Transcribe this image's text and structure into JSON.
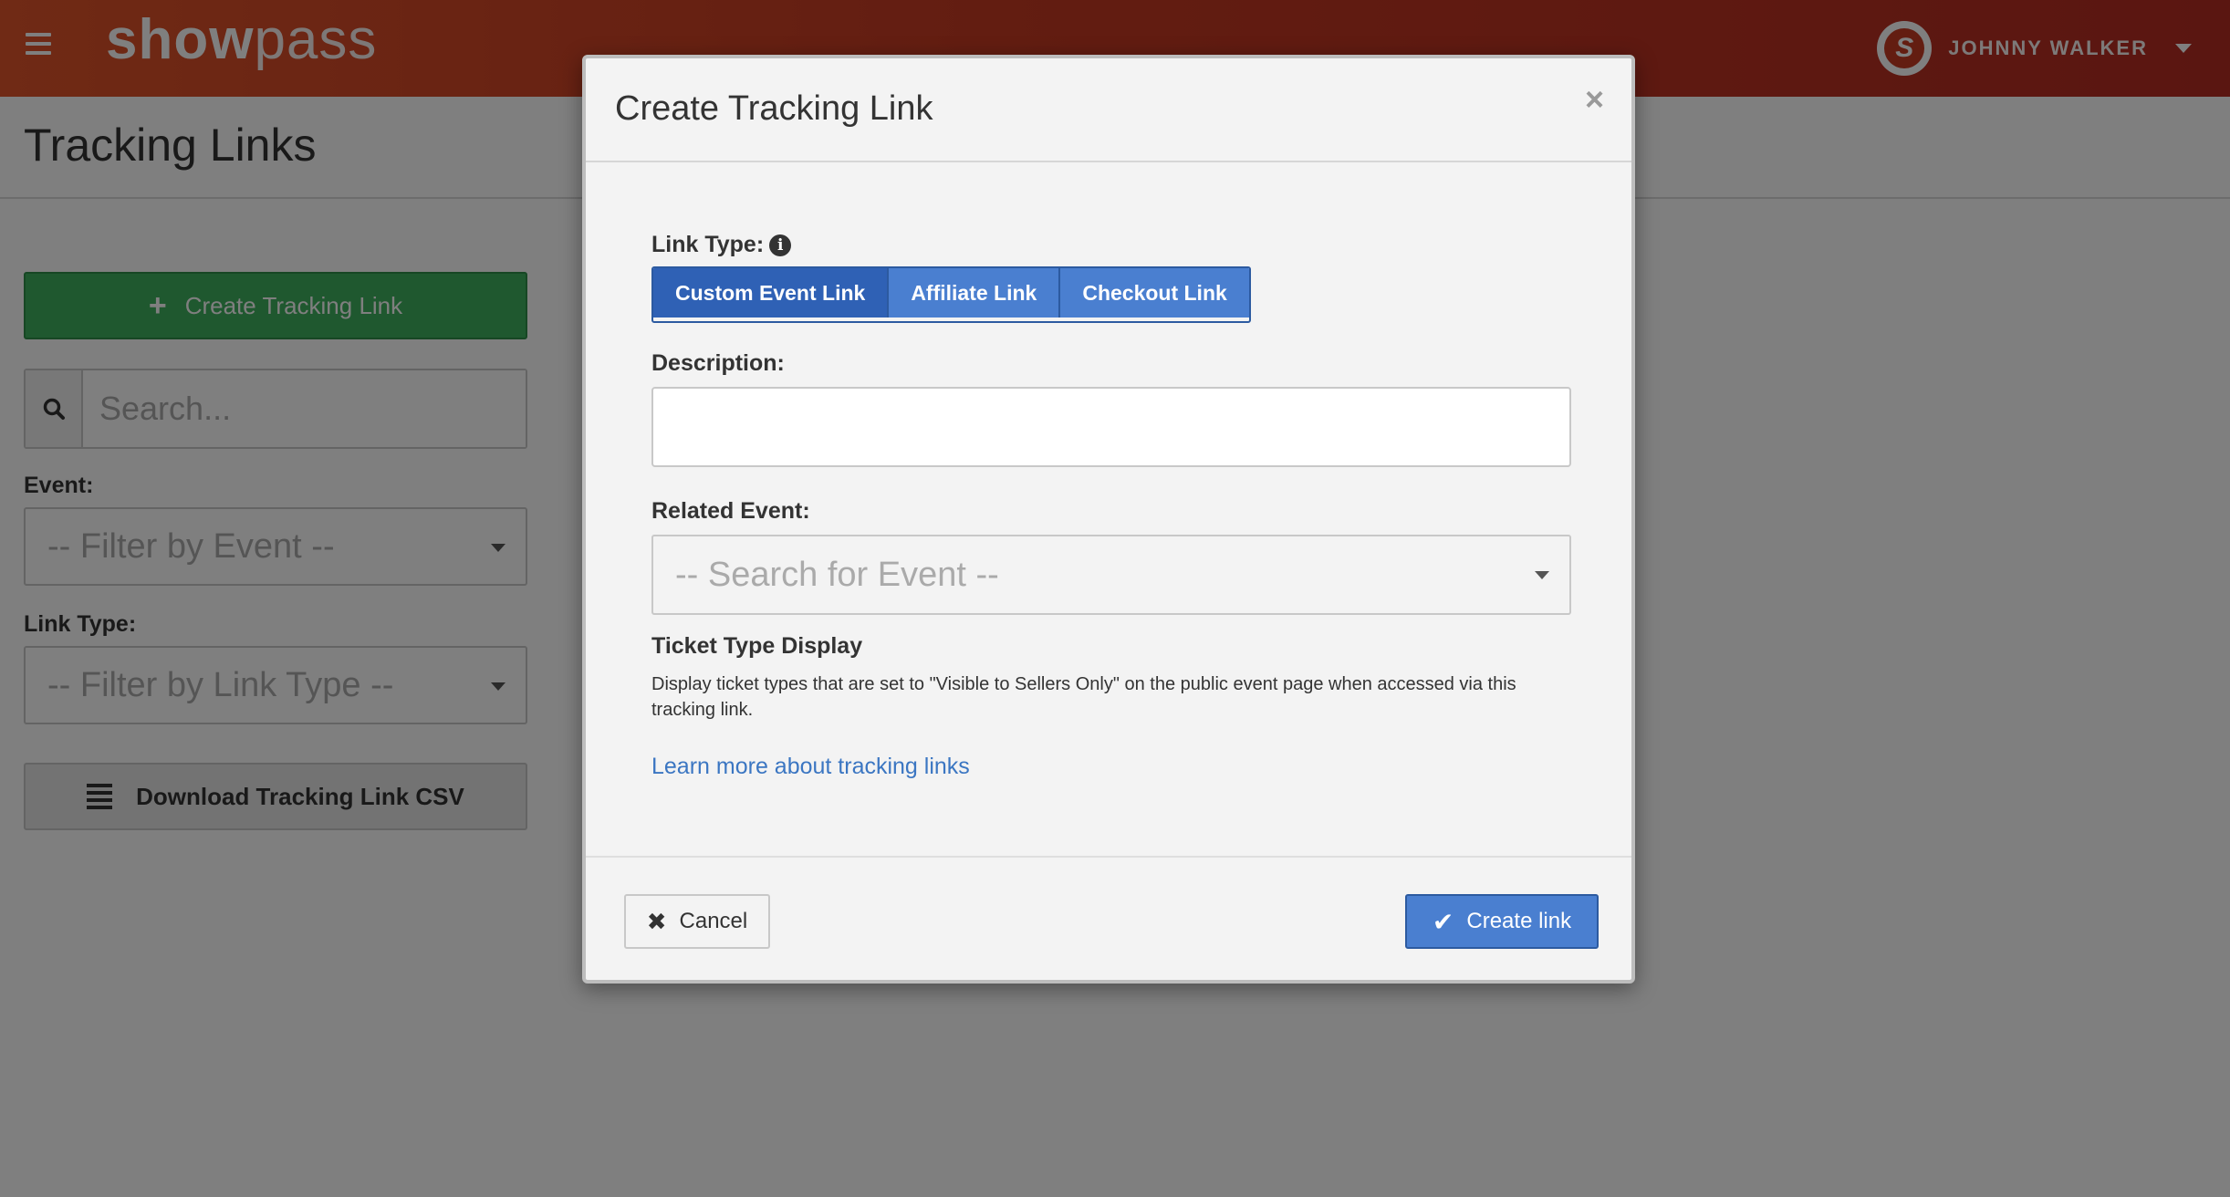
{
  "app": {
    "logo_bold": "show",
    "logo_light": "pass",
    "user_name": "JOHNNY WALKER",
    "avatar_letter": "S"
  },
  "page": {
    "title": "Tracking Links"
  },
  "sidebar": {
    "create_button": "Create Tracking Link",
    "search_placeholder": "Search...",
    "event_label": "Event:",
    "event_placeholder": "-- Filter by Event --",
    "link_type_label": "Link Type:",
    "link_type_placeholder": "-- Filter by Link Type --",
    "download_button": "Download Tracking Link CSV"
  },
  "modal": {
    "title": "Create Tracking Link",
    "close": "×",
    "link_type_label": "Link Type:",
    "link_types": [
      "Custom Event Link",
      "Affiliate Link",
      "Checkout Link"
    ],
    "selected_link_type": "Custom Event Link",
    "description_label": "Description:",
    "description_value": "",
    "related_event_label": "Related Event:",
    "related_event_placeholder": "-- Search for Event --",
    "ticket_display_title": "Ticket Type Display",
    "ticket_display_desc": "Display ticket types that are set to \"Visible to Sellers Only\" on the public event page when accessed via this tracking link.",
    "learn_more": "Learn more about tracking links",
    "cancel_button": "Cancel",
    "submit_button": "Create link"
  },
  "colors": {
    "topbar": "#c63a23",
    "create_green": "#3fb05e",
    "primary_blue": "#4a7fd0",
    "active_blue": "#2f61b5",
    "link_blue": "#3b76c2"
  }
}
